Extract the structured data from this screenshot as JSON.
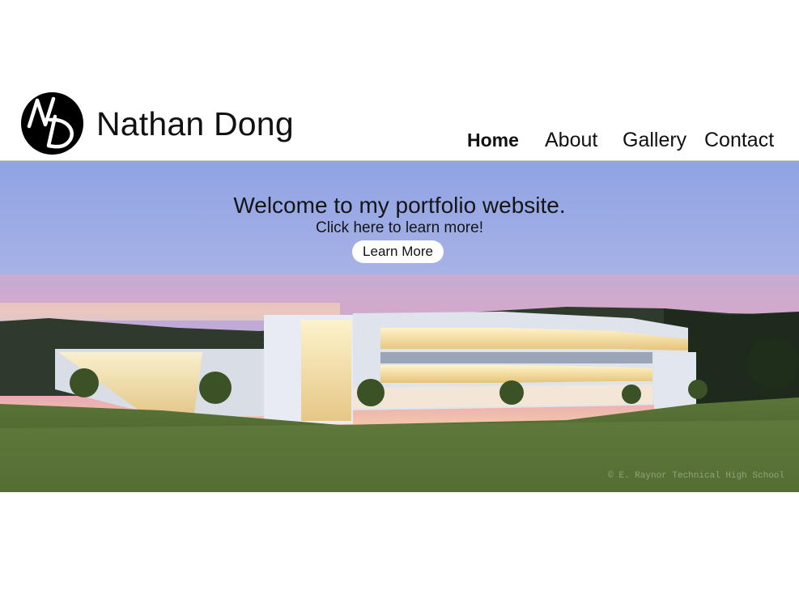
{
  "header": {
    "logo_text": "ND",
    "site_title": "Nathan Dong",
    "nav": {
      "home": "Home",
      "about": "About",
      "gallery": "Gallery",
      "contact": "Contact"
    },
    "active_nav": "home"
  },
  "hero": {
    "heading": "Welcome to my portfolio website.",
    "subheading": "Click here to learn more!",
    "button_label": "Learn More",
    "watermark": "© E. Raynor Technical High School",
    "image_icon": "building-photo"
  },
  "colors": {
    "logo_bg": "#000000",
    "logo_fg": "#ffffff",
    "button_bg": "#ffffff",
    "text": "#111111"
  }
}
